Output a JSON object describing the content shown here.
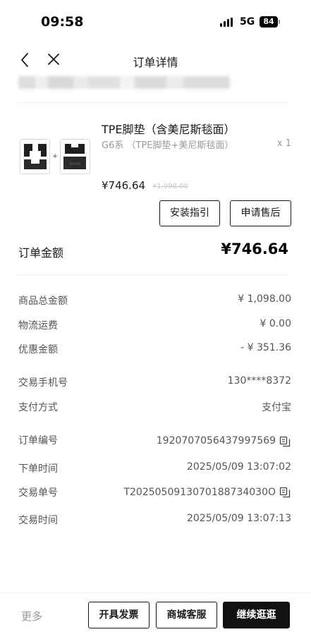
{
  "status_bar": {
    "time": "09:58",
    "network": "5G",
    "battery": "84"
  },
  "nav": {
    "title": "订单详情",
    "back_icon": "chevron-left-icon",
    "close_icon": "close-icon"
  },
  "product": {
    "name": "TPE脚垫（含美尼斯毯面）",
    "spec": "G6系 （TPE脚垫+美尼斯毯面）",
    "quantity": "x 1",
    "price": "¥746.64",
    "original_price": "¥1,098.00",
    "thumb_plus": "+",
    "buttons": {
      "install_guide": "安装指引",
      "after_sales": "申请售后"
    }
  },
  "order_amount": {
    "label": "订单金额",
    "value": "¥746.64"
  },
  "details": {
    "subtotal": {
      "label": "商品总金额",
      "value": "¥ 1,098.00"
    },
    "shipping": {
      "label": "物流运费",
      "value": "¥ 0.00"
    },
    "discount": {
      "label": "优惠金额",
      "value": "- ¥ 351.36"
    },
    "phone": {
      "label": "交易手机号",
      "value": "130****8372"
    },
    "payment": {
      "label": "支付方式",
      "value": "支付宝"
    },
    "order_no": {
      "label": "订单编号",
      "value": "1920707056437997569"
    },
    "order_time": {
      "label": "下单时间",
      "value": "2025/05/09 13:07:02"
    },
    "trade_no": {
      "label": "交易单号",
      "value": "T2025050913070188734030O"
    },
    "trade_time": {
      "label": "交易时间",
      "value": "2025/05/09 13:07:13"
    }
  },
  "footer": {
    "more": "更多",
    "invoice": "开具发票",
    "service": "商城客服",
    "continue": "继续逛逛"
  },
  "colors": {
    "primary_dark": "#111111",
    "muted_text": "#999999"
  }
}
